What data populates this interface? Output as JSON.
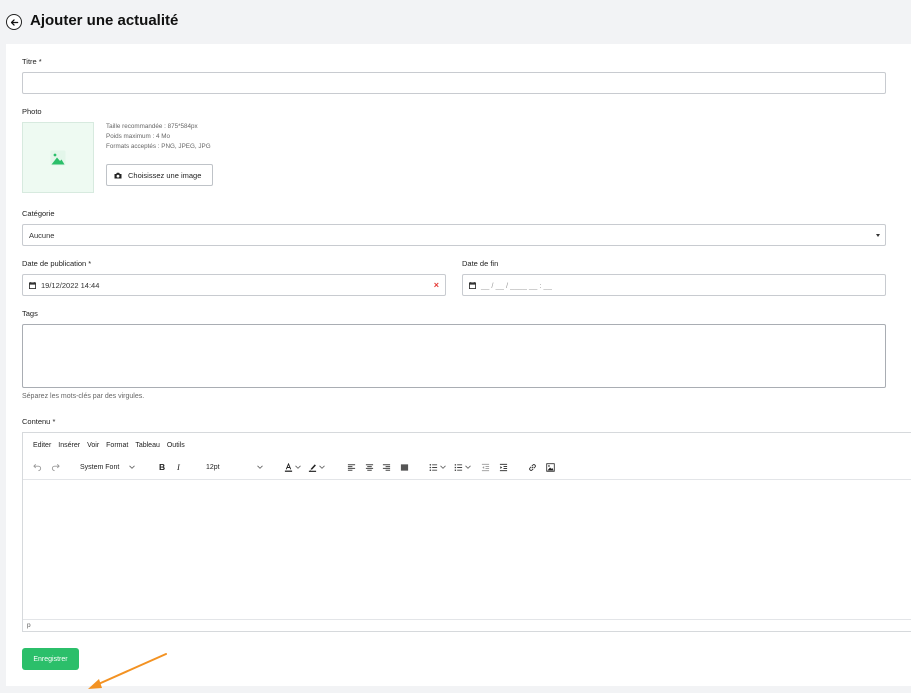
{
  "header": {
    "title": "Ajouter une actualité"
  },
  "form": {
    "title_label": "Titre *",
    "title_value": "",
    "photo_label": "Photo",
    "photo_info": [
      "Taille recommandée : 875*584px",
      "Poids maximum : 4 Mo",
      "Formats acceptés : PNG, JPEG, JPG"
    ],
    "choose_image": "Choisissez une image",
    "category_label": "Catégorie",
    "category_value": "Aucune",
    "pub_date_label": "Date de publication *",
    "pub_date_value": "19/12/2022 14:44",
    "end_date_label": "Date de fin",
    "end_date_placeholder": "__ / __ / ____ __ : __",
    "tags_label": "Tags",
    "tags_hint": "Séparez les mots-clés par des virgules.",
    "content_label": "Contenu *"
  },
  "editor": {
    "menu": [
      "Editer",
      "Insérer",
      "Voir",
      "Format",
      "Tableau",
      "Outils"
    ],
    "font_family": "System Font",
    "font_size": "12pt",
    "status_path": "p"
  },
  "actions": {
    "save_label": "Enregistrer"
  },
  "colors": {
    "accent": "#2bbf6a",
    "arrow": "#f39222",
    "clear": "#e53935"
  }
}
